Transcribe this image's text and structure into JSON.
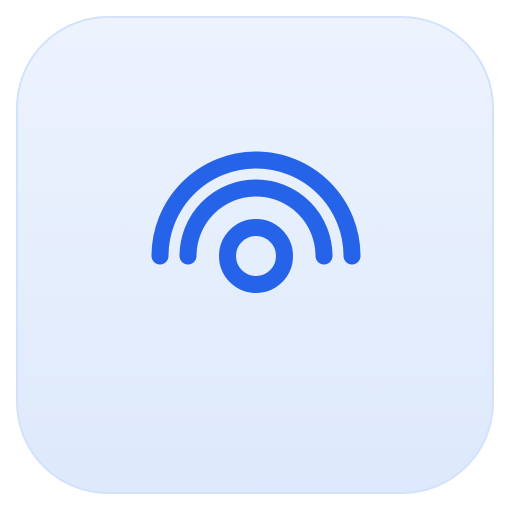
{
  "app_icon": {
    "icon": "broadcast-signal-icon",
    "background_top": "#edf3fd",
    "background_bottom": "#dde9fc",
    "border_color": "#d3e2fb",
    "glyph_color": "#2563e8"
  }
}
